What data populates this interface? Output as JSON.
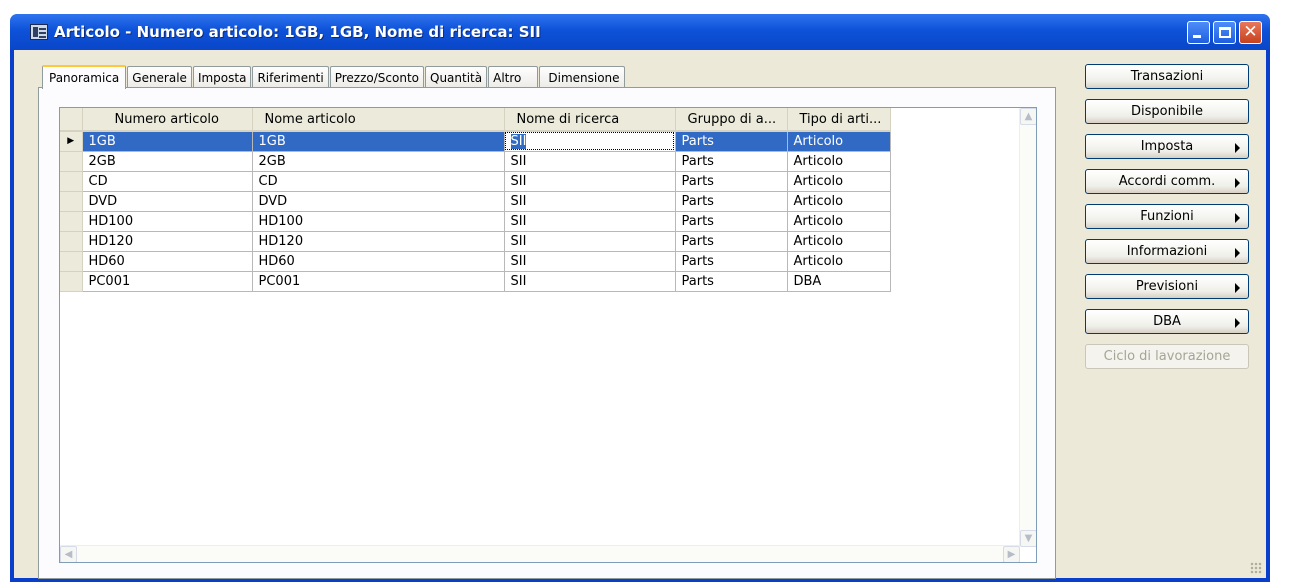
{
  "window": {
    "title": "Articolo - Numero articolo: 1GB, 1GB, Nome di ricerca: SII"
  },
  "tabs": [
    {
      "label": "Panoramica",
      "active": true
    },
    {
      "label": "Generale"
    },
    {
      "label": "Imposta"
    },
    {
      "label": "Riferimenti"
    },
    {
      "label": "Prezzo/Sconto"
    },
    {
      "label": "Quantità"
    },
    {
      "label": "Altro"
    },
    {
      "label": "Dimensione"
    }
  ],
  "grid": {
    "columns": [
      "Numero articolo",
      "Nome articolo",
      "Nome di ricerca",
      "Gruppo di a...",
      "Tipo di arti..."
    ],
    "rows": [
      [
        "1GB",
        "1GB",
        "SII",
        "Parts",
        "Articolo"
      ],
      [
        "2GB",
        "2GB",
        "SII",
        "Parts",
        "Articolo"
      ],
      [
        "CD",
        "CD",
        "SII",
        "Parts",
        "Articolo"
      ],
      [
        "DVD",
        "DVD",
        "SII",
        "Parts",
        "Articolo"
      ],
      [
        "HD100",
        "HD100",
        "SII",
        "Parts",
        "Articolo"
      ],
      [
        "HD120",
        "HD120",
        "SII",
        "Parts",
        "Articolo"
      ],
      [
        "HD60",
        "HD60",
        "SII",
        "Parts",
        "Articolo"
      ],
      [
        "PC001",
        "PC001",
        "SII",
        "Parts",
        "DBA"
      ]
    ],
    "selected_row": 0,
    "row_marker": "▶"
  },
  "buttons": [
    {
      "label": "Transazioni",
      "submenu": false,
      "enabled": true
    },
    {
      "label": "Disponibile",
      "submenu": false,
      "enabled": true
    },
    {
      "label": "Imposta",
      "submenu": true,
      "enabled": true
    },
    {
      "label": "Accordi comm.",
      "submenu": true,
      "enabled": true
    },
    {
      "label": "Funzioni",
      "submenu": true,
      "enabled": true
    },
    {
      "label": "Informazioni",
      "submenu": true,
      "enabled": true
    },
    {
      "label": "Previsioni",
      "submenu": true,
      "enabled": true
    },
    {
      "label": "DBA",
      "submenu": true,
      "enabled": true
    },
    {
      "label": "Ciclo di lavorazione",
      "submenu": false,
      "enabled": false
    }
  ],
  "colors": {
    "titlebar": "#0d52d8",
    "selection": "#316ac5",
    "tab_highlight": "#ffc83c"
  }
}
